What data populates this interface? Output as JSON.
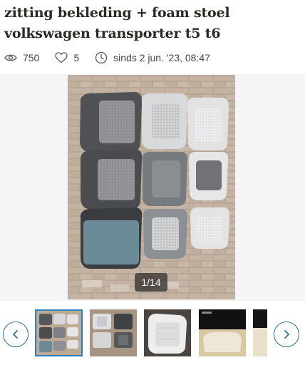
{
  "listing": {
    "title": "zitting bekleding + foam stoel volkswagen transporter t5 t6",
    "views": "750",
    "favorites": "5",
    "since": "sinds 2 jun. '23, 08:47"
  },
  "gallery": {
    "counter": "1/14",
    "thumbnails": [
      {
        "name": "thumbnail-1",
        "active": true
      },
      {
        "name": "thumbnail-2",
        "active": false
      },
      {
        "name": "thumbnail-3",
        "active": false
      },
      {
        "name": "thumbnail-4",
        "active": false
      },
      {
        "name": "thumbnail-5",
        "active": false
      }
    ]
  },
  "icons": {
    "views": "eye-icon",
    "favorites": "heart-icon",
    "since": "clock-icon",
    "prev": "chevron-left-icon",
    "next": "chevron-right-icon"
  },
  "colors": {
    "accent": "#2c6e9c",
    "title": "#2d2a26"
  }
}
